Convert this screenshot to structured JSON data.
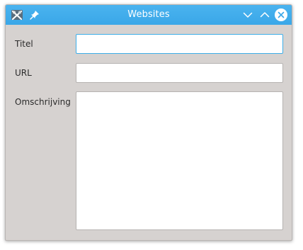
{
  "window": {
    "title": "Websites",
    "app_icon": "kde-app-icon",
    "pin_icon": "pin-icon",
    "controls": [
      "minimize-chevron-down-icon",
      "maximize-chevron-up-icon",
      "close-icon"
    ]
  },
  "form": {
    "title_label": "Titel",
    "title_value": "",
    "url_label": "URL",
    "url_value": "",
    "description_label": "Omschrijving",
    "description_value": ""
  },
  "colors": {
    "titlebar": "#3daee9",
    "window_bg": "#d6d2d0",
    "focus_border": "#3daee9"
  }
}
